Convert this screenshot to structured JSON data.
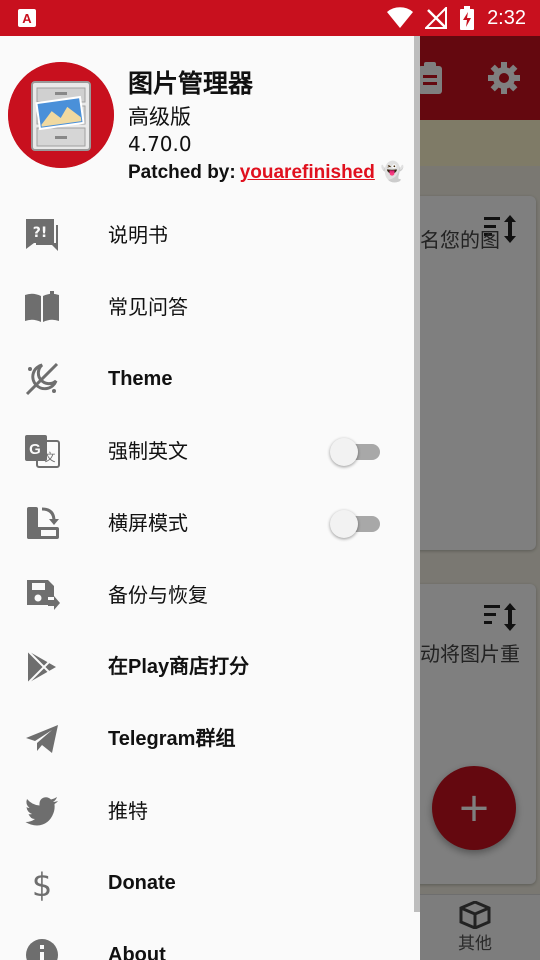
{
  "status_bar": {
    "time": "2:32"
  },
  "background": {
    "card_1_text": "名您的图",
    "card_2_text": "动将图片重",
    "bottom_tab_label": "其他",
    "fab_label": "+"
  },
  "drawer": {
    "app_name": "图片管理器",
    "edition": "高级版",
    "version": "4.70.0",
    "patched_prefix": "Patched by:",
    "patched_author": "youarefinished",
    "patched_emoji": "👻",
    "items": [
      {
        "label": "说明书",
        "icon": "manual-icon"
      },
      {
        "label": "常见问答",
        "icon": "book-icon"
      },
      {
        "label": "Theme",
        "icon": "theme-icon"
      },
      {
        "label": "强制英文",
        "icon": "translate-icon",
        "toggle": false
      },
      {
        "label": "横屏模式",
        "icon": "screen-rotation-icon",
        "toggle": false
      },
      {
        "label": "备份与恢复",
        "icon": "backup-icon"
      },
      {
        "label": "在Play商店打分",
        "icon": "play-store-icon"
      },
      {
        "label": "Telegram群组",
        "icon": "telegram-icon"
      },
      {
        "label": "推特",
        "icon": "twitter-icon"
      },
      {
        "label": "Donate",
        "icon": "dollar-icon"
      },
      {
        "label": "About",
        "icon": "info-icon"
      }
    ]
  },
  "colors": {
    "brand_red": "#c8101e",
    "link_red": "#e0101e",
    "icon_gray": "#6e6e6e"
  }
}
